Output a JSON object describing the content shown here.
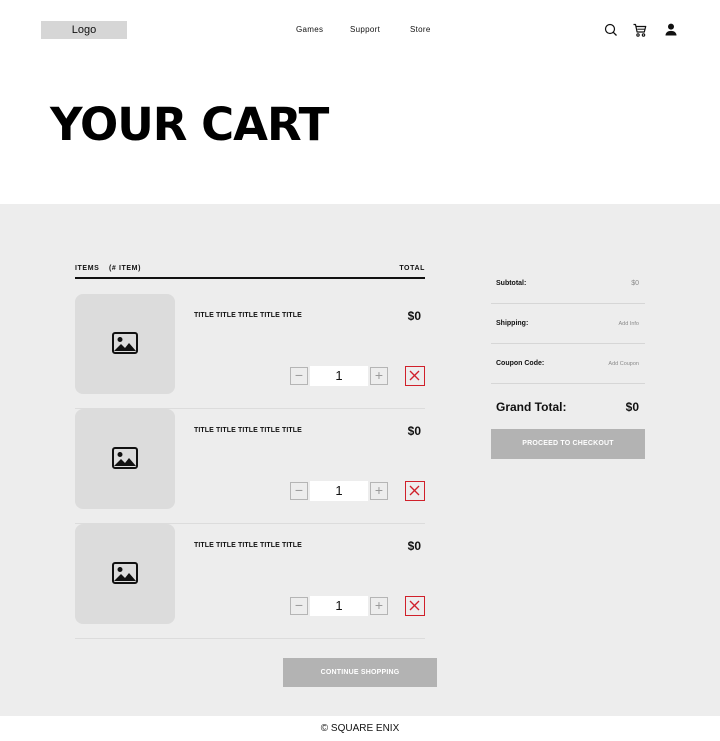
{
  "header": {
    "logo": "Logo",
    "nav": [
      "Games",
      "Support",
      "Store"
    ],
    "icons": [
      "search-icon",
      "cart-icon",
      "user-icon"
    ]
  },
  "page": {
    "title": "YOUR CART"
  },
  "items_header": {
    "label": "ITEMS",
    "count": "(# ITEM)",
    "total": "TOTAL"
  },
  "items": [
    {
      "title": "TITLE TITLE TITLE TITLE TITLE",
      "price": "$0",
      "qty": "1"
    },
    {
      "title": "TITLE TITLE TITLE TITLE TITLE",
      "price": "$0",
      "qty": "1"
    },
    {
      "title": "TITLE TITLE TITLE TITLE TITLE",
      "price": "$0",
      "qty": "1"
    }
  ],
  "qty_controls": {
    "minus": "−",
    "plus": "+"
  },
  "summary": {
    "subtotal_label": "Subtotal:",
    "subtotal_value": "$0",
    "shipping_label": "Shipping:",
    "shipping_value": "Add Info",
    "coupon_label": "Coupon Code:",
    "coupon_value": "Add Coupon",
    "grand_label": "Grand Total:",
    "grand_value": "$0",
    "checkout": "PROCEED TO CHECKOUT"
  },
  "continue": "CONTINUE SHOPPING",
  "footer": "© SQUARE ENIX",
  "colors": {
    "section_bg": "#ededed",
    "button_bg": "#b3b3b3",
    "remove_red": "#d0202a",
    "thumb_bg": "#dcdcdc"
  }
}
